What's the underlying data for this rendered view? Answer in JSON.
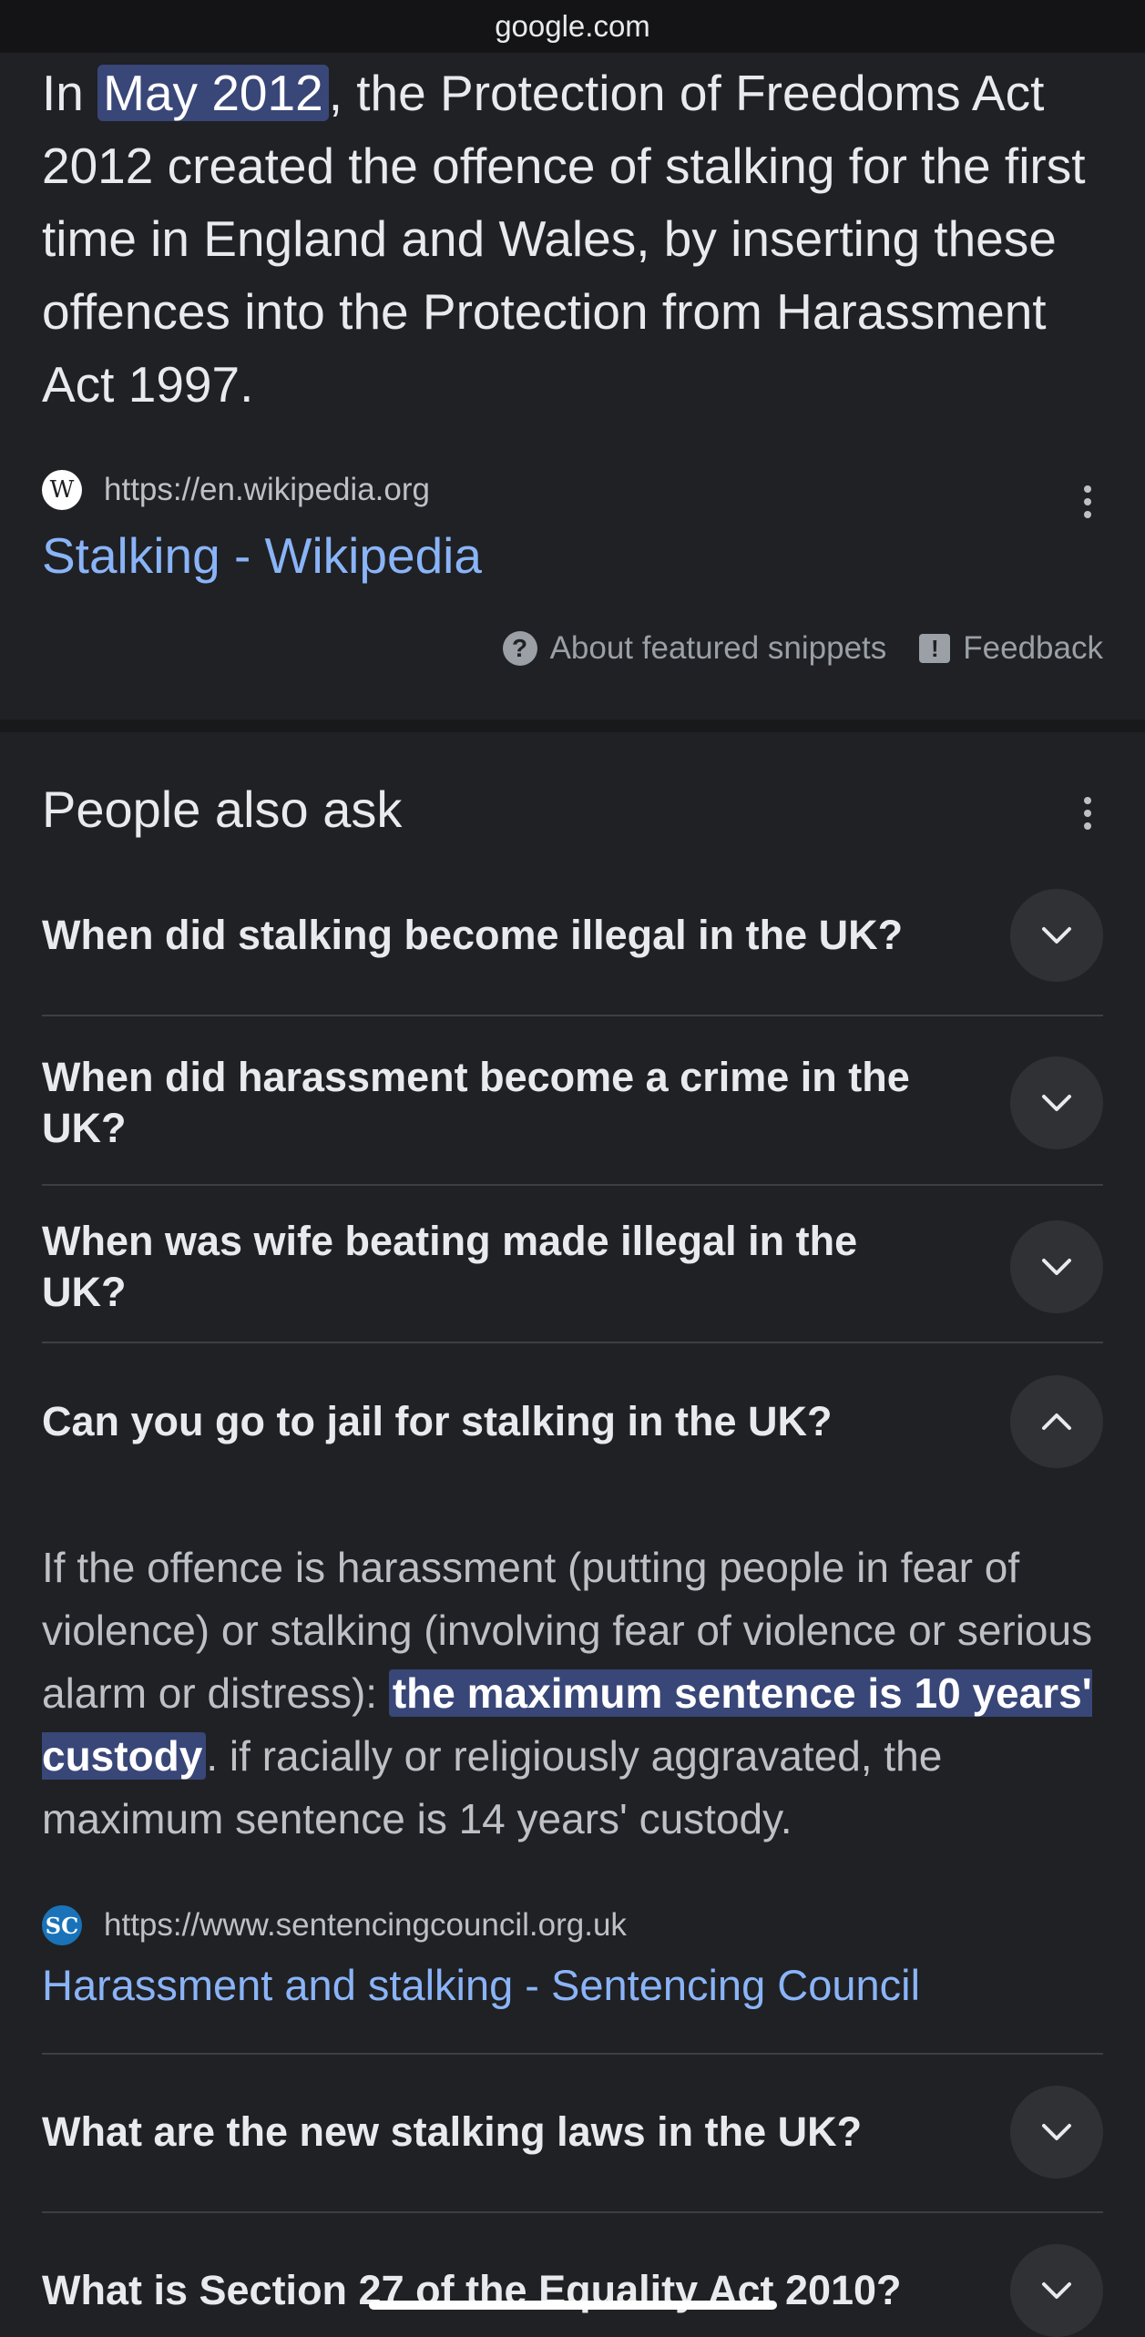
{
  "browser": {
    "url": "google.com"
  },
  "featured_snippet": {
    "text_before": "In ",
    "highlight": "May 2012",
    "text_after": ", the Protection of Freedoms Act 2012 created the offence of stalking for the first time in England and Wales, by inserting these offences into the Protection from Harassment Act 1997.",
    "source_icon_letter": "W",
    "source_url": "https://en.wikipedia.org",
    "source_title": "Stalking - Wikipedia",
    "about_label": "About featured snippets",
    "feedback_label": "Feedback"
  },
  "people_also_ask": {
    "title": "People also ask",
    "questions": [
      {
        "text": "When did stalking become illegal in the UK?",
        "expanded": false
      },
      {
        "text": "When did harassment become a crime in the UK?",
        "expanded": false
      },
      {
        "text": "When was wife beating made illegal in the UK?",
        "expanded": false
      },
      {
        "text": "Can you go to jail for stalking in the UK?",
        "expanded": true
      },
      {
        "text": "What are the new stalking laws in the UK?",
        "expanded": false
      },
      {
        "text": "What is Section 27 of the Equality Act 2010?",
        "expanded": false
      }
    ],
    "answer": {
      "text_before": "If the offence is harassment (putting people in fear of violence) or stalking (involving fear of violence or serious alarm or distress): ",
      "highlight": "the maximum sentence is 10 years' custody",
      "text_after": ". if racially or religiously aggravated, the maximum sentence is 14 years' custody.",
      "source_icon_letter": "SC",
      "source_url": "https://www.sentencingcouncil.org.uk",
      "source_title": "Harassment and stalking - Sentencing Council"
    }
  },
  "colors": {
    "background": "#202124",
    "link": "#8ab4f8",
    "highlight": "#394678",
    "chevron_bg": "#303134"
  }
}
